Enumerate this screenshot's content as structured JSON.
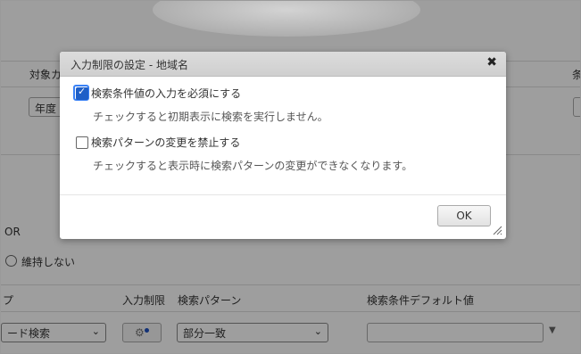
{
  "background": {
    "header_label_left": "対象カ",
    "header_label_right": "条",
    "year_field_text": "年度",
    "or_label": "OR",
    "keep_none_label": "維持しない",
    "col_label_1": "プ",
    "col_label_input_restriction": "入力制限",
    "col_label_search_pattern": "検索パターン",
    "col_label_default_value": "検索条件デフォルト値",
    "select_search_mode": "ード検索",
    "select_partial_match": "部分一致",
    "chevron": "⌄"
  },
  "dialog": {
    "title": "入力制限の設定 - 地域名",
    "close_symbol": "✖",
    "options": [
      {
        "label": "検索条件値の入力を必須にする",
        "description": "チェックすると初期表示に検索を実行しません。",
        "checked": true
      },
      {
        "label": "検索パターンの変更を禁止する",
        "description": "チェックすると表示時に検索パターンの変更ができなくなります。",
        "checked": false
      }
    ],
    "ok_label": "OK"
  },
  "colors": {
    "checkbox_checked": "#1f5fc7",
    "focus_ring": "#3b82f6",
    "gear_dot": "#1d4fbf"
  }
}
